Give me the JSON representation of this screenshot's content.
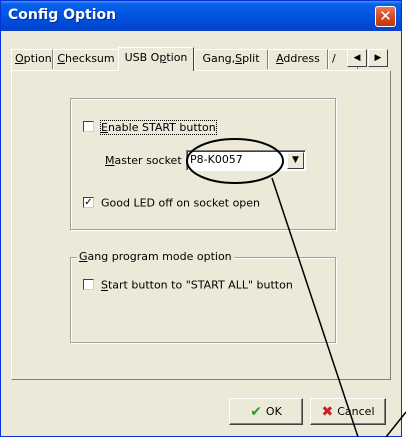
{
  "window": {
    "title": "Config Option",
    "close_glyph": "✕"
  },
  "tabs": [
    {
      "label": "Option",
      "mnemonic": "O",
      "rest": "ption",
      "active": false
    },
    {
      "label": "Checksum",
      "mnemonic": "C",
      "rest": "hecksum",
      "active": false
    },
    {
      "label": "USB Option",
      "pre": "USB O",
      "mnemonic": "p",
      "rest": "tion",
      "active": true
    },
    {
      "label": "Gang,Split",
      "pre": "Gang,",
      "mnemonic": "S",
      "rest": "plit",
      "active": false
    },
    {
      "label": "Address",
      "mnemonic": "A",
      "rest": "ddress",
      "active": false
    },
    {
      "label": "/",
      "active": false
    }
  ],
  "tab_scroll": {
    "left_glyph": "◀",
    "right_glyph": "▶"
  },
  "usb_group": {
    "enable_start": {
      "mnemonic": "E",
      "rest": "nable START button",
      "checked": false
    },
    "master_socket": {
      "mnemonic": "M",
      "rest": "aster socket",
      "value": "P8-K0057"
    },
    "good_led": {
      "label": "Good LED off on socket open",
      "checked": true,
      "check_glyph": "✓"
    }
  },
  "gang_group": {
    "title_mnemonic": "G",
    "title_rest": "ang program mode option",
    "start_all": {
      "mnemonic": "S",
      "rest": "tart button to \"START ALL\" button",
      "checked": false
    }
  },
  "buttons": {
    "ok": {
      "label": "OK",
      "icon_glyph": "✔",
      "icon_color": "#2a9a2a"
    },
    "cancel": {
      "label": "Cancel",
      "icon_glyph": "✖",
      "icon_color": "#cc2020"
    }
  },
  "colors": {
    "title_bar": "#0055e5",
    "window_face": "#ece9d8",
    "annotation": "#000000"
  }
}
